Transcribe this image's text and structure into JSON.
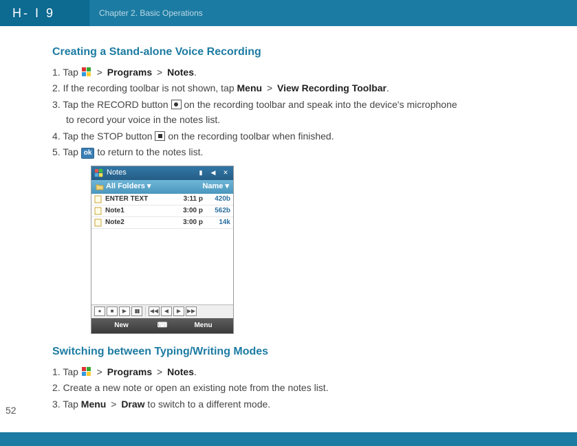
{
  "header": {
    "logo_text": "H- I 9",
    "chapter": "Chapter 2. Basic Operations"
  },
  "section1": {
    "title": "Creating a Stand-alone Voice Recording",
    "step1": {
      "num": "1. ",
      "tap": "Tap ",
      "gt1": " > ",
      "programs": "Programs",
      "gt2": " > ",
      "notes": "Notes",
      "end": "."
    },
    "step2": {
      "num": "2. ",
      "a": "If the recording toolbar is not shown, tap ",
      "menu": "Menu",
      "gt": " > ",
      "vrt": "View Recording Toolbar",
      "end": "."
    },
    "step3": {
      "num": "3. ",
      "a": "Tap the RECORD button ",
      "b": " on the recording toolbar and speak into the device's microphone",
      "cont": "to record your voice in the notes list."
    },
    "step4": {
      "num": "4. ",
      "a": "Tap the STOP button ",
      "b": " on the recording toolbar when finished."
    },
    "step5": {
      "num": "5. ",
      "a": "Tap ",
      "ok": "ok",
      "b": " to return to the notes list."
    }
  },
  "device": {
    "title": "Notes",
    "folders": "All Folders ▾",
    "name_col": "Name ▾",
    "rows": [
      {
        "name": "ENTER TEXT",
        "time": "3:11 p",
        "size": "420b"
      },
      {
        "name": "Note1",
        "time": "3:00 p",
        "size": "562b"
      },
      {
        "name": "Note2",
        "time": "3:00 p",
        "size": "14k"
      }
    ],
    "soft_left": "New",
    "soft_right": "Menu"
  },
  "section2": {
    "title": "Switching between Typing/Writing Modes",
    "step1": {
      "num": "1. ",
      "tap": "Tap ",
      "gt1": " > ",
      "programs": "Programs",
      "gt2": " > ",
      "notes": "Notes",
      "end": "."
    },
    "step2": {
      "num": "2. ",
      "text": "Create a new note or open an existing note from the notes list."
    },
    "step3": {
      "num": "3. ",
      "a": "Tap ",
      "menu": "Menu",
      "gt": " > ",
      "draw": "Draw",
      "b": " to switch to a different mode."
    }
  },
  "page_number": "52"
}
